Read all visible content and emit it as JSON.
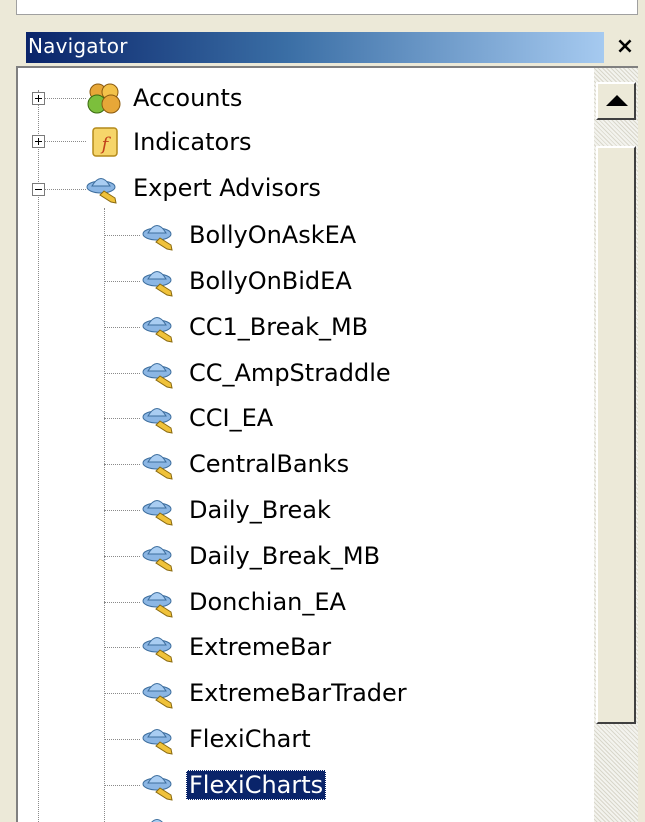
{
  "navigator": {
    "title": "Navigator",
    "close_glyph": "×"
  },
  "tree": {
    "roots": [
      {
        "label": "Accounts",
        "icon": "accounts-icon",
        "state": "collapsed"
      },
      {
        "label": "Indicators",
        "icon": "indicators-icon",
        "state": "collapsed"
      },
      {
        "label": "Expert Advisors",
        "icon": "expert-advisor-icon",
        "state": "expanded"
      }
    ],
    "expert_advisors": [
      {
        "label": "BollyOnAskEA"
      },
      {
        "label": "BollyOnBidEA"
      },
      {
        "label": "CC1_Break_MB"
      },
      {
        "label": "CC_AmpStraddle"
      },
      {
        "label": "CCI_EA"
      },
      {
        "label": "CentralBanks"
      },
      {
        "label": "Daily_Break"
      },
      {
        "label": "Daily_Break_MB"
      },
      {
        "label": "Donchian_EA"
      },
      {
        "label": "ExtremeBar"
      },
      {
        "label": "ExtremeBarTrader"
      },
      {
        "label": "FlexiChart"
      },
      {
        "label": "FlexiCharts",
        "selected": true
      }
    ]
  },
  "colors": {
    "title_bar_start": "#0a246a",
    "title_bar_end": "#a6caf0",
    "selection": "#0a246a"
  }
}
